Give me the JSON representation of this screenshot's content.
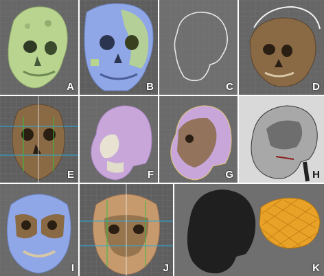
{
  "figure": {
    "panels": [
      {
        "id": "A",
        "label": "A",
        "subject": "green-skull-3d"
      },
      {
        "id": "B",
        "label": "B",
        "subject": "blue-green-skull-overlay"
      },
      {
        "id": "C",
        "label": "C",
        "subject": "skull-outline"
      },
      {
        "id": "D",
        "label": "D",
        "subject": "textured-skull-with-arc"
      },
      {
        "id": "E",
        "label": "E",
        "subject": "frontal-skull-with-guides"
      },
      {
        "id": "F",
        "label": "F",
        "subject": "pink-head-lateral"
      },
      {
        "id": "G",
        "label": "G",
        "subject": "head-skull-overlay"
      },
      {
        "id": "H",
        "label": "H",
        "subject": "sagittal-xray"
      },
      {
        "id": "I",
        "label": "I",
        "subject": "blue-frontal-skull"
      },
      {
        "id": "J",
        "label": "J",
        "subject": "reconstructed-face-guides"
      },
      {
        "id": "K",
        "label": "K",
        "subject": "dark-head-and-orange-mesh"
      }
    ],
    "colors": {
      "gridBg": "#6c6c6c",
      "skullGreen": "#b9d48f",
      "skullBlue": "#8fa7e6",
      "skullBrown": "#8a6a45",
      "headPink": "#c8a6d9",
      "headTan": "#c79a6e",
      "orangeMesh": "#e9a228"
    }
  }
}
